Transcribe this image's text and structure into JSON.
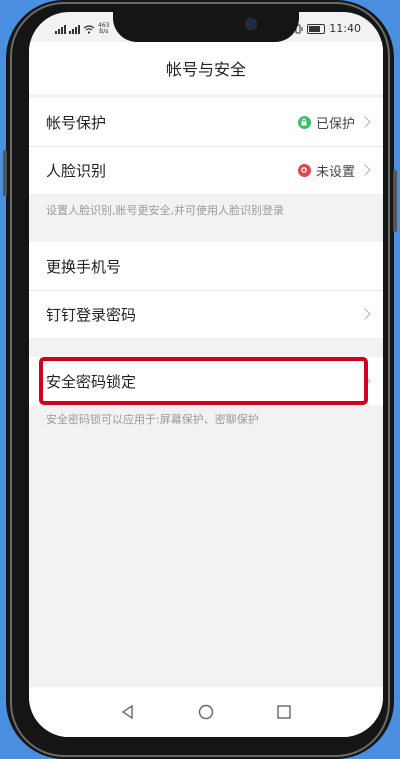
{
  "status_bar": {
    "network_speed_top": "463",
    "network_speed_unit": "B/s",
    "time": "11:40"
  },
  "header": {
    "title": "帐号与安全"
  },
  "group1": {
    "account_protection": {
      "label": "帐号保护",
      "value": "已保护"
    },
    "face_recognition": {
      "label": "人脸识别",
      "value": "未设置"
    },
    "note": "设置人脸识别,账号更安全,并可使用人脸识别登录"
  },
  "group2": {
    "change_phone": {
      "label": "更换手机号"
    },
    "login_password": {
      "label": "钉钉登录密码"
    }
  },
  "group3": {
    "security_lock": {
      "label": "安全密码锁定"
    },
    "note": "安全密码锁可以应用于:屏幕保护、密聊保护"
  },
  "colors": {
    "protected_green": "#3bbf6b",
    "unset_red": "#e0464b",
    "highlight_red": "#d0021b"
  },
  "icons": [
    "back-triangle-icon",
    "home-circle-icon",
    "recents-square-icon"
  ]
}
